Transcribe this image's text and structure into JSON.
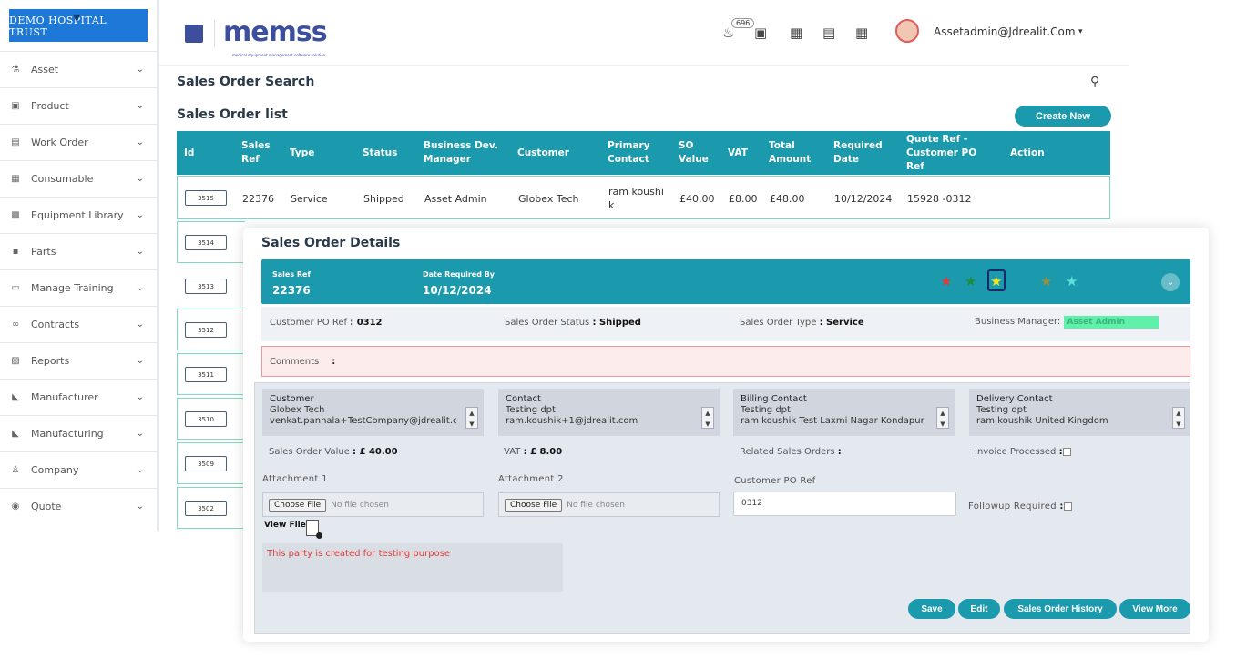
{
  "brand": {
    "hospital_name": "DEMO HOSPITAL TRUST",
    "app_name": "memss",
    "app_tagline": "medical equipment management software solution"
  },
  "sidebar": {
    "items": [
      {
        "label": "Asset",
        "icon": "asset-icon"
      },
      {
        "label": "Product",
        "icon": "product-icon"
      },
      {
        "label": "Work Order",
        "icon": "work-order-icon"
      },
      {
        "label": "Consumable",
        "icon": "grid-icon"
      },
      {
        "label": "Equipment Library",
        "icon": "library-icon"
      },
      {
        "label": "Parts",
        "icon": "parts-icon"
      },
      {
        "label": "Manage Training",
        "icon": "monitor-icon"
      },
      {
        "label": "Contracts",
        "icon": "handshake-icon"
      },
      {
        "label": "Reports",
        "icon": "report-icon"
      },
      {
        "label": "Manufacturer",
        "icon": "factory-icon"
      },
      {
        "label": "Manufacturing",
        "icon": "factory-icon"
      },
      {
        "label": "Company",
        "icon": "building-icon"
      },
      {
        "label": "Quote",
        "icon": "quote-icon"
      }
    ]
  },
  "header": {
    "notification_count": "696",
    "user_email": "Assetadmin@Jdrealit.Com"
  },
  "list_page": {
    "search_title": "Sales Order Search",
    "list_title": "Sales Order list",
    "create_button": "Create New",
    "columns": [
      "Id",
      "Sales Ref",
      "Type",
      "Status",
      "Business Dev. Manager",
      "Customer",
      "Primary Contact",
      "SO Value",
      "VAT",
      "Total Amount",
      "Required Date",
      "Quote Ref - Customer PO Ref",
      "Action"
    ],
    "first_row": {
      "id": "3515",
      "sales_ref": "22376",
      "type": "Service",
      "status": "Shipped",
      "manager": "Asset Admin",
      "customer": "Globex Tech",
      "contact": "ram koushik",
      "so_value": "£40.00",
      "vat": "£8.00",
      "total": "£48.00",
      "required_date": "10/12/2024",
      "quote_ref": "15928 -0312"
    },
    "other_ids": [
      "3514",
      "3513",
      "3512",
      "3511",
      "3510",
      "3509",
      "3502"
    ]
  },
  "modal": {
    "title": "Sales Order Details",
    "sales_ref_label": "Sales Ref",
    "sales_ref": "22376",
    "date_label": "Date Required By",
    "date_required": "10/12/2024",
    "star_colors": [
      "#e53935",
      "#1e8c3a",
      "#f5e51b",
      "#1a9aac",
      "#9a8f3a",
      "#5fe0d8"
    ],
    "customer_po_label": "Customer PO Ref",
    "customer_po": "0312",
    "status_label": "Sales Order Status",
    "status": "Shipped",
    "type_label": "Sales Order Type",
    "type": "Service",
    "manager_label": "Business Manager:",
    "manager": "Asset Admin",
    "comments_label": "Comments",
    "comments_sep": ":",
    "customer_card": {
      "title": "Customer",
      "line1": "Globex Tech",
      "line2": "venkat.pannala+TestCompany@jdrealit.c"
    },
    "contact_card": {
      "title": "Contact",
      "line1": "Testing dpt",
      "line2": "ram.koushik+1@jdrealit.com"
    },
    "billing_card": {
      "title": "Billing Contact",
      "line1": "Testing dpt",
      "line2": "ram koushik Test Laxmi Nagar Kondapur"
    },
    "delivery_card": {
      "title": "Delivery Contact",
      "line1": "Testing dpt",
      "line2": "ram koushik United Kingdom"
    },
    "so_value_label": "Sales Order Value",
    "so_value": "£ 40.00",
    "vat_label": "VAT",
    "vat": "£ 8.00",
    "related_label": "Related Sales Orders",
    "invoice_label": "Invoice Processed",
    "attachment1_label": "Attachment 1",
    "attachment2_label": "Attachment 2",
    "po_ref_label": "Customer PO Ref",
    "po_ref_value": "0312",
    "followup_label": "Followup Required",
    "choose_file": "Choose File",
    "no_file": "No file chosen",
    "view_file": "View File",
    "note": "This party is created for testing purpose",
    "buttons": {
      "save": "Save",
      "edit": "Edit",
      "history": "Sales Order History",
      "view_more": "View More"
    }
  }
}
